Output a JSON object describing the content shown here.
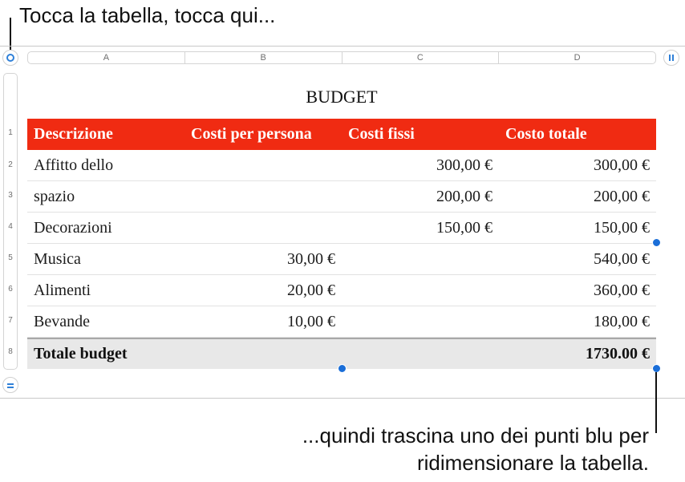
{
  "callouts": {
    "top": "Tocca la tabella, tocca qui...",
    "bottom_line1": "...quindi trascina uno dei punti blu per",
    "bottom_line2": "ridimensionare la tabella."
  },
  "column_headers": [
    "A",
    "B",
    "C",
    "D"
  ],
  "row_numbers": [
    "1",
    "2",
    "3",
    "4",
    "5",
    "6",
    "7",
    "8"
  ],
  "table": {
    "title": "BUDGET",
    "header": [
      "Descrizione",
      "Costi per persona",
      "Costi fissi",
      "Costo totale"
    ],
    "rows": [
      [
        "Affitto dello",
        "",
        "300,00 €",
        "300,00 €"
      ],
      [
        "spazio",
        "",
        "200,00 €",
        "200,00 €"
      ],
      [
        "Decorazioni",
        "",
        "150,00 €",
        "150,00 €"
      ],
      [
        "Musica",
        "30,00 €",
        "",
        "540,00 €"
      ],
      [
        "Alimenti",
        "20,00 €",
        "",
        "360,00 €"
      ],
      [
        "Bevande",
        "10,00 €",
        "",
        "180,00 €"
      ]
    ],
    "total": [
      "Totale budget",
      "",
      "",
      "1730.00 €"
    ]
  },
  "colors": {
    "header_fill": "#f02b12",
    "total_fill": "#e8e8e8",
    "handle": "#1a6ed8",
    "control_accent": "#2f80d8"
  },
  "icons": [
    "select-table-circle-icon",
    "pause-columns-icon",
    "rows-equal-icon"
  ]
}
